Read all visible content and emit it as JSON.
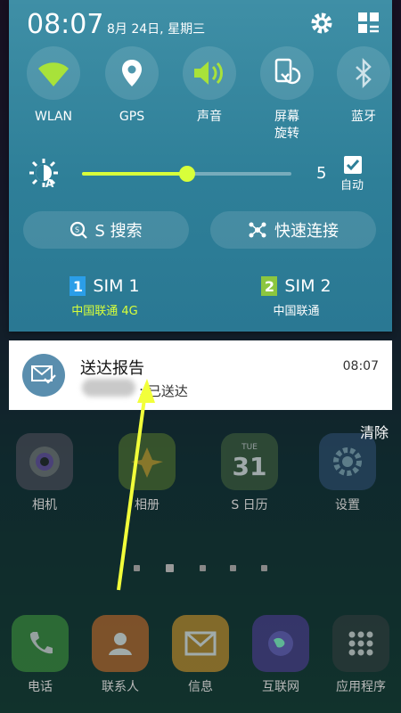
{
  "status": {
    "time": "08:07",
    "date": "8月 24日, 星期三"
  },
  "quick_settings": [
    {
      "label": "WLAN",
      "icon": "wifi-icon",
      "active": true
    },
    {
      "label": "GPS",
      "icon": "location-icon",
      "active": false
    },
    {
      "label": "声音",
      "icon": "volume-icon",
      "active": true
    },
    {
      "label": "屏幕\n旋转",
      "icon": "screen-rotation-icon",
      "active": false
    },
    {
      "label": "蓝牙",
      "icon": "bluetooth-icon",
      "active": false
    }
  ],
  "brightness": {
    "level": 0.5,
    "value": "5",
    "auto_label": "自动",
    "auto_checked": true
  },
  "buttons": {
    "s_search": "S 搜索",
    "quick_connect": "快速连接"
  },
  "sim": [
    {
      "badge": "1",
      "name": "SIM 1",
      "carrier": "中国联通 4G",
      "color": "#2b9ee8",
      "carrier_color": "#d8ff3a"
    },
    {
      "badge": "2",
      "name": "SIM 2",
      "carrier": "中国联通",
      "color": "#8cc63f",
      "carrier_color": "#ffffff"
    }
  ],
  "notification": {
    "title": "送达报告",
    "time": "08:07",
    "body": ": 已送达"
  },
  "clear_label": "清除",
  "home_apps_row1": [
    {
      "label": "相机",
      "icon": "camera-icon"
    },
    {
      "label": "相册",
      "icon": "gallery-icon"
    },
    {
      "label": "S 日历",
      "icon": "calendar-icon",
      "calendar_day": "TUE",
      "calendar_date": "31"
    },
    {
      "label": "设置",
      "icon": "settings-icon"
    }
  ],
  "dock_apps": [
    {
      "label": "电话",
      "icon": "phone-icon"
    },
    {
      "label": "联系人",
      "icon": "contacts-icon"
    },
    {
      "label": "信息",
      "icon": "messages-icon"
    },
    {
      "label": "互联网",
      "icon": "internet-icon"
    },
    {
      "label": "应用程序",
      "icon": "apps-icon"
    }
  ],
  "colors": {
    "accent": "#d8ff3a",
    "shade": "#2e7f98",
    "annotation_arrow": "#f2ff3a"
  }
}
